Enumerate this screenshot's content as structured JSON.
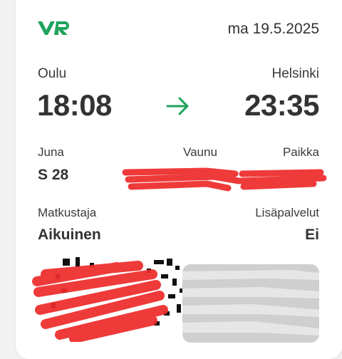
{
  "brand": {
    "logo_text": "VR",
    "color": "#1fa35d"
  },
  "date": "ma 19.5.2025",
  "journey": {
    "from": "Oulu",
    "departure_time": "18:08",
    "to": "Helsinki",
    "arrival_time": "23:35",
    "arrow_icon": "arrow-right-icon"
  },
  "train": {
    "label": "Juna",
    "value": "S 28"
  },
  "car": {
    "label": "Vaunu",
    "value": ""
  },
  "seat": {
    "label": "Paikka",
    "value": ""
  },
  "passenger": {
    "label": "Matkustaja",
    "value": "Aikuinen"
  },
  "extras": {
    "label": "Lisäpalvelut",
    "value": "Ei"
  },
  "colors": {
    "accent": "#1fa35d",
    "redaction": "#ee2a2a"
  }
}
